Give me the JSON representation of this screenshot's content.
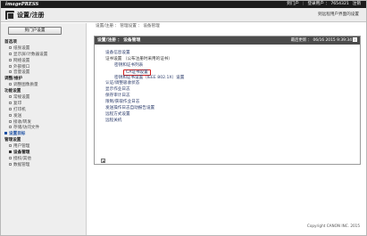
{
  "brand": "imagePRESS",
  "toplinks": [
    "到门户",
    "登录用户 ： 7654321",
    "注销"
  ],
  "title": "设置/注册",
  "title_link": "到远程用户界面的设置",
  "sidebar": {
    "button": "到门户设置",
    "sections": [
      {
        "label": "首选项",
        "items": [
          "纸张设置",
          "显示屏/计数器设置",
          "网络设置",
          "外部接口",
          "音量设置"
        ]
      },
      {
        "label": "调整/维护",
        "items": [
          "调整图像质量"
        ]
      },
      {
        "label": "功能设置",
        "items": [
          "常规设置",
          "复印",
          "打印机",
          "发送",
          "接收/转发",
          "存储/访问文件"
        ]
      },
      {
        "label": "设置目标",
        "items": []
      },
      {
        "label": "管理设置",
        "items": [
          "用户管理",
          "设备管理",
          "授权/其他",
          "数据管理"
        ]
      }
    ],
    "active_item": "设备管理"
  },
  "breadcrumb": "设置/注册 ： 管理设置 ： 设备管理",
  "panel": {
    "title": "设置/注册 ： 设备管理",
    "timestamp": "最后更新 ： 06/16 2015 9:39:34",
    "items": [
      {
        "text": "设备信息设置",
        "level": 1,
        "link": true
      },
      {
        "text": "证书设置",
        "level": 1,
        "link": false,
        "note": "（公布注册时采用的证书）"
      },
      {
        "text": "密钥和证书列表",
        "level": 2,
        "link": true
      },
      {
        "text": "CA证书设置",
        "level": 2,
        "link": true,
        "highlight": true
      },
      {
        "text": "密钥和证书设置（IEEE 802.1X）设置",
        "level": 2,
        "link": true
      },
      {
        "text": "认证/调整吸收状态",
        "level": 1,
        "link": true
      },
      {
        "text": "显示作业日志",
        "level": 1,
        "link": true
      },
      {
        "text": "保存审计日志",
        "level": 1,
        "link": true
      },
      {
        "text": "限制/获取作业日志",
        "level": 1,
        "link": true
      },
      {
        "text": "发送操作日志自动报告设置",
        "level": 1,
        "link": true
      },
      {
        "text": "远程方式设置",
        "level": 1,
        "link": true
      },
      {
        "text": "远程关机",
        "level": 1,
        "link": true
      }
    ]
  },
  "footer": "Copyright CANON INC. 2015"
}
